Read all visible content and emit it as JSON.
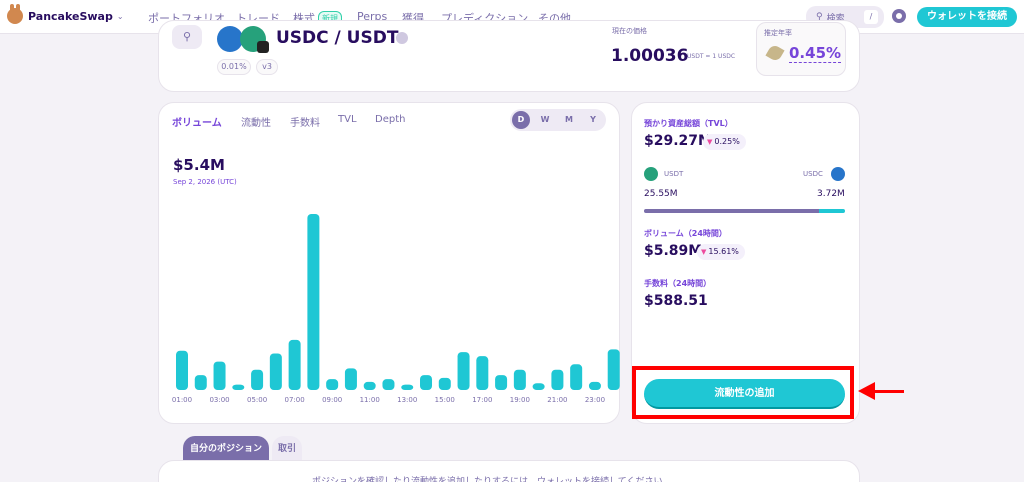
{
  "nav": {
    "brand": "PancakeSwap",
    "items": [
      {
        "label": "ポートフォリオ"
      },
      {
        "label": "トレード"
      },
      {
        "label": "株式",
        "badge": "新規"
      },
      {
        "label": "Perps"
      },
      {
        "label": "獲得"
      },
      {
        "label": "プレディクション"
      },
      {
        "label": "その他"
      }
    ],
    "search_placeholder": "検索",
    "search_shortcut": "/",
    "connect_label": "ウォレットを接続"
  },
  "pool": {
    "pair": "USDC / USDT",
    "fee_tier": "0.01%",
    "version": "v3",
    "price_label": "現在の価格",
    "price": "1.00036",
    "price_unit": "USDT = 1 USDC",
    "apr_label": "推定年率",
    "apr": "0.45%"
  },
  "chart_tabs": [
    {
      "label": "ボリューム",
      "active": true
    },
    {
      "label": "流動性",
      "active": false
    },
    {
      "label": "手数料",
      "active": false
    },
    {
      "label": "TVL",
      "active": false
    },
    {
      "label": "Depth",
      "active": false
    }
  ],
  "periods": [
    {
      "label": "D",
      "active": true
    },
    {
      "label": "W",
      "active": false
    },
    {
      "label": "M",
      "active": false
    },
    {
      "label": "Y",
      "active": false
    }
  ],
  "chart_summary": {
    "value": "$5.4M",
    "date": "Sep 2, 2026 (UTC)"
  },
  "chart_data": {
    "type": "bar",
    "title": "",
    "xlabel": "",
    "ylabel": "",
    "x_tick_labels": [
      "01:00",
      "03:00",
      "05:00",
      "07:00",
      "09:00",
      "11:00",
      "13:00",
      "15:00",
      "17:00",
      "19:00",
      "21:00",
      "23:00"
    ],
    "categories": [
      "00:00",
      "01:00",
      "02:00",
      "03:00",
      "04:00",
      "05:00",
      "06:00",
      "07:00",
      "08:00",
      "09:00",
      "10:00",
      "11:00",
      "12:00",
      "13:00",
      "14:00",
      "15:00",
      "16:00",
      "17:00",
      "18:00",
      "19:00",
      "20:00",
      "21:00",
      "22:00",
      "23:00"
    ],
    "values": [
      0.29,
      0.11,
      0.21,
      0.04,
      0.15,
      0.27,
      0.37,
      1.3,
      0.08,
      0.16,
      0.06,
      0.08,
      0.04,
      0.11,
      0.09,
      0.28,
      0.25,
      0.11,
      0.15,
      0.05,
      0.15,
      0.19,
      0.06,
      0.3
    ],
    "unit": "$M",
    "color": "#1fc7d4"
  },
  "stats": {
    "tvl_label": "預かり資産総額（TVL）",
    "tvl": "$29.27M",
    "tvl_change": "0.25%",
    "token_a": "USDT",
    "token_b": "USDC",
    "amount_a": "25.55M",
    "amount_b": "3.72M",
    "share_a": 0.873,
    "volume_label": "ボリューム（24時間）",
    "volume": "$5.89M",
    "volume_change": "15.61%",
    "fees_label": "手数料（24時間）",
    "fees": "$588.51",
    "add_liquidity": "流動性の追加"
  },
  "positions": {
    "tabs": [
      "自分のポジション",
      "取引"
    ],
    "message": "ポジションを確認したり流動性を追加したりするには、ウォレットを接続してください"
  },
  "colors": {
    "primary": "#1fc7d4",
    "secondary": "#7645d9",
    "text": "#280d5f",
    "highlight": "#ff0000"
  }
}
